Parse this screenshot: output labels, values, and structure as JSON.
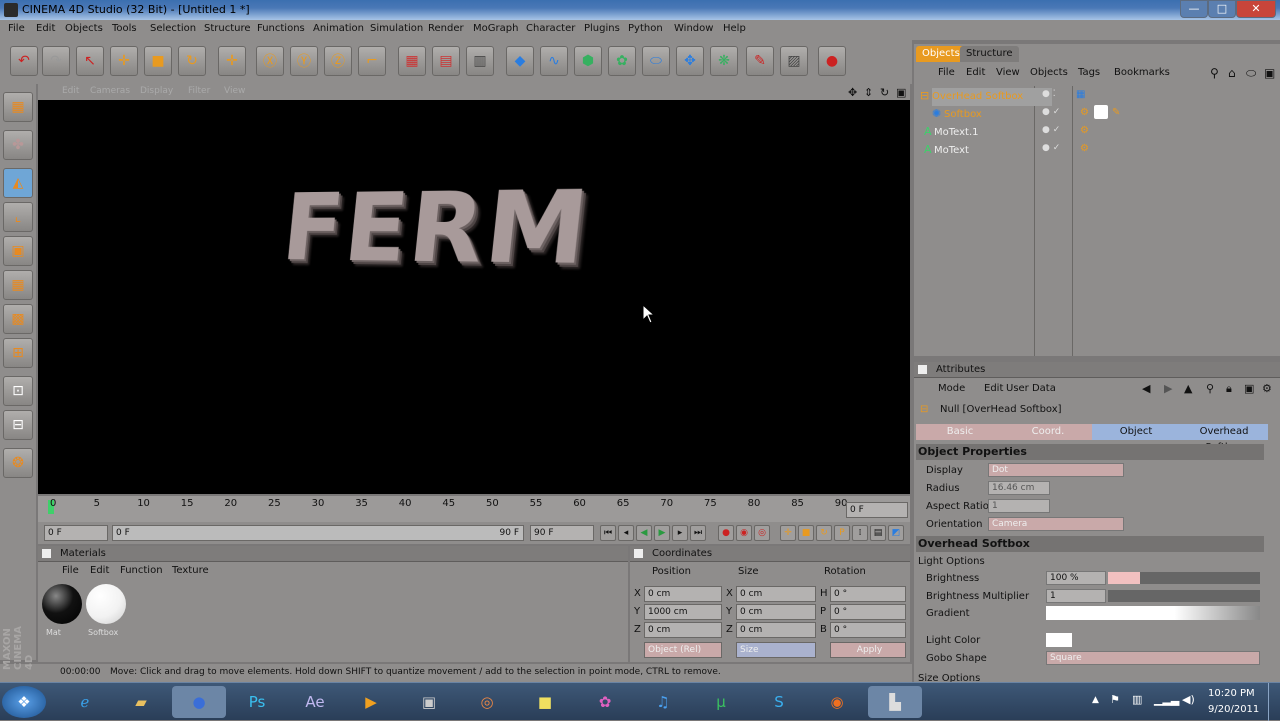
{
  "window": {
    "title": "CINEMA 4D Studio (32 Bit) - [Untitled 1 *]",
    "minimize": "—",
    "maximize": "□",
    "close": "✕"
  },
  "menubar": {
    "items": [
      "File",
      "Edit",
      "Objects",
      "Tools",
      "Selection",
      "Structure",
      "Functions",
      "Animation",
      "Simulation",
      "Render",
      "MoGraph",
      "Character",
      "Plugins",
      "Python",
      "Window",
      "Help"
    ]
  },
  "viewport": {
    "menu": [
      "Edit",
      "Cameras",
      "Display",
      "Filter",
      "View"
    ],
    "scene_text": "FERM"
  },
  "timeline": {
    "ticks": [
      "0",
      "5",
      "10",
      "15",
      "20",
      "25",
      "30",
      "35",
      "40",
      "45",
      "50",
      "55",
      "60",
      "65",
      "70",
      "75",
      "80",
      "85",
      "90"
    ],
    "current_frame": "0 F",
    "start_frame": "0 F",
    "range_start": "0 F",
    "range_end": "90 F",
    "end_frame": "90 F"
  },
  "materials": {
    "header": "Materials",
    "menu": [
      "File",
      "Edit",
      "Function",
      "Texture"
    ],
    "items": [
      {
        "name": "Mat",
        "color": "#111111"
      },
      {
        "name": "Softbox",
        "color": "#f2f2f2"
      }
    ]
  },
  "coordinates": {
    "header": "Coordinates",
    "columns": [
      "Position",
      "Size",
      "Rotation"
    ],
    "rows": [
      {
        "pos_axis": "X",
        "pos": "0 cm",
        "size_axis": "X",
        "size": "0 cm",
        "rot_axis": "H",
        "rot": "0 °"
      },
      {
        "pos_axis": "Y",
        "pos": "1000 cm",
        "size_axis": "Y",
        "size": "0 cm",
        "rot_axis": "P",
        "rot": "0 °"
      },
      {
        "pos_axis": "Z",
        "pos": "0 cm",
        "size_axis": "Z",
        "size": "0 cm",
        "rot_axis": "B",
        "rot": "0 °"
      }
    ],
    "mode_select": "Object (Rel)",
    "size_select": "Size",
    "apply_label": "Apply"
  },
  "statusbar": {
    "time": "00:00:00",
    "message": "Move: Click and drag to move elements. Hold down SHIFT to quantize movement / add to the selection in point mode, CTRL to remove."
  },
  "object_manager": {
    "tabs": [
      "Objects",
      "Structure"
    ],
    "menu": [
      "File",
      "Edit",
      "View",
      "Objects",
      "Tags",
      "Bookmarks"
    ],
    "objects": [
      {
        "name": "OverHead Softbox",
        "color": "#f0a020"
      },
      {
        "name": "Softbox",
        "color": "#f0a020"
      },
      {
        "name": "MoText.1",
        "color": "#3ed06a"
      },
      {
        "name": "MoText",
        "color": "#3ed06a"
      }
    ]
  },
  "attributes": {
    "header": "Attributes",
    "menu": [
      "Mode",
      "Edit",
      "User Data"
    ],
    "object_name": "Null [OverHead Softbox]",
    "tabs": [
      "Basic",
      "Coord.",
      "Object",
      "Overhead Softbox"
    ],
    "object_properties": {
      "title": "Object Properties",
      "display_label": "Display",
      "display_value": "Dot",
      "radius_label": "Radius",
      "radius_value": "16.46 cm",
      "aspect_label": "Aspect Ratio",
      "aspect_value": "1",
      "orientation_label": "Orientation",
      "orientation_value": "Camera"
    },
    "overhead_softbox": {
      "title": "Overhead Softbox",
      "light_options": "Light Options",
      "brightness_label": "Brightness",
      "brightness_value": "100 %",
      "multiplier_label": "Brightness Multiplier",
      "multiplier_value": "1",
      "gradient_label": "Gradient",
      "light_color_label": "Light Color",
      "gobo_label": "Gobo Shape",
      "gobo_value": "Square",
      "size_options": "Size Options"
    }
  },
  "taskbar": {
    "clock_time": "10:20 PM",
    "clock_date": "9/20/2011"
  },
  "branding": {
    "logo_text": "MAXON CINEMA 4D"
  }
}
